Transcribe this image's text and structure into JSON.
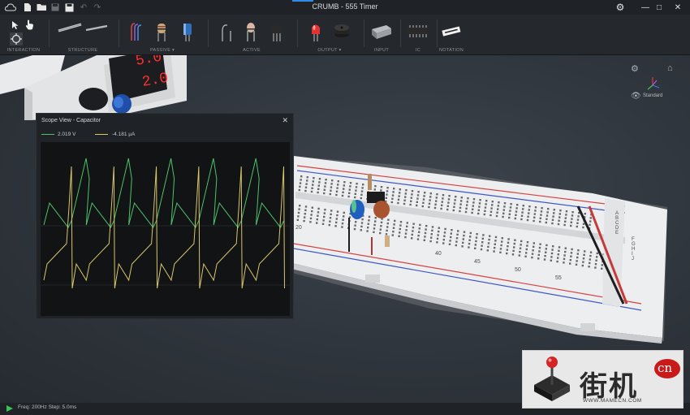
{
  "app": {
    "title": "CRUMB - 555 Timer"
  },
  "toolbar": {
    "groups": [
      {
        "label": "INTERACTION"
      },
      {
        "label": "STRUCTURE"
      },
      {
        "label": "PASSIVE ▾"
      },
      {
        "label": "ACTIVE"
      },
      {
        "label": "OUTPUT ▾"
      },
      {
        "label": "INPUT"
      },
      {
        "label": "IC"
      },
      {
        "label": "NOTATION"
      }
    ]
  },
  "psu": {
    "voltage": "5.0",
    "current": "2.0"
  },
  "scope": {
    "title": "Scope View - Capacitor",
    "close": "✕",
    "voltage_readout": "2.019 V",
    "current_readout": "-4.181 μA",
    "voltage_color": "#4cc36a",
    "current_color": "#d8c66a"
  },
  "view": {
    "label": "Standard"
  },
  "status": {
    "text": "Freq: 200Hz  Step: 5.0ms"
  },
  "watermark": {
    "brand": "街机",
    "badge": "cn",
    "url": "WWW.MAMECN.COM"
  },
  "breadboard": {
    "row_numbers": [
      "20",
      "40",
      "45",
      "50",
      "55"
    ],
    "rail_letters": [
      "A",
      "B",
      "C",
      "D",
      "E",
      "F",
      "G",
      "H",
      "I",
      "J"
    ]
  }
}
